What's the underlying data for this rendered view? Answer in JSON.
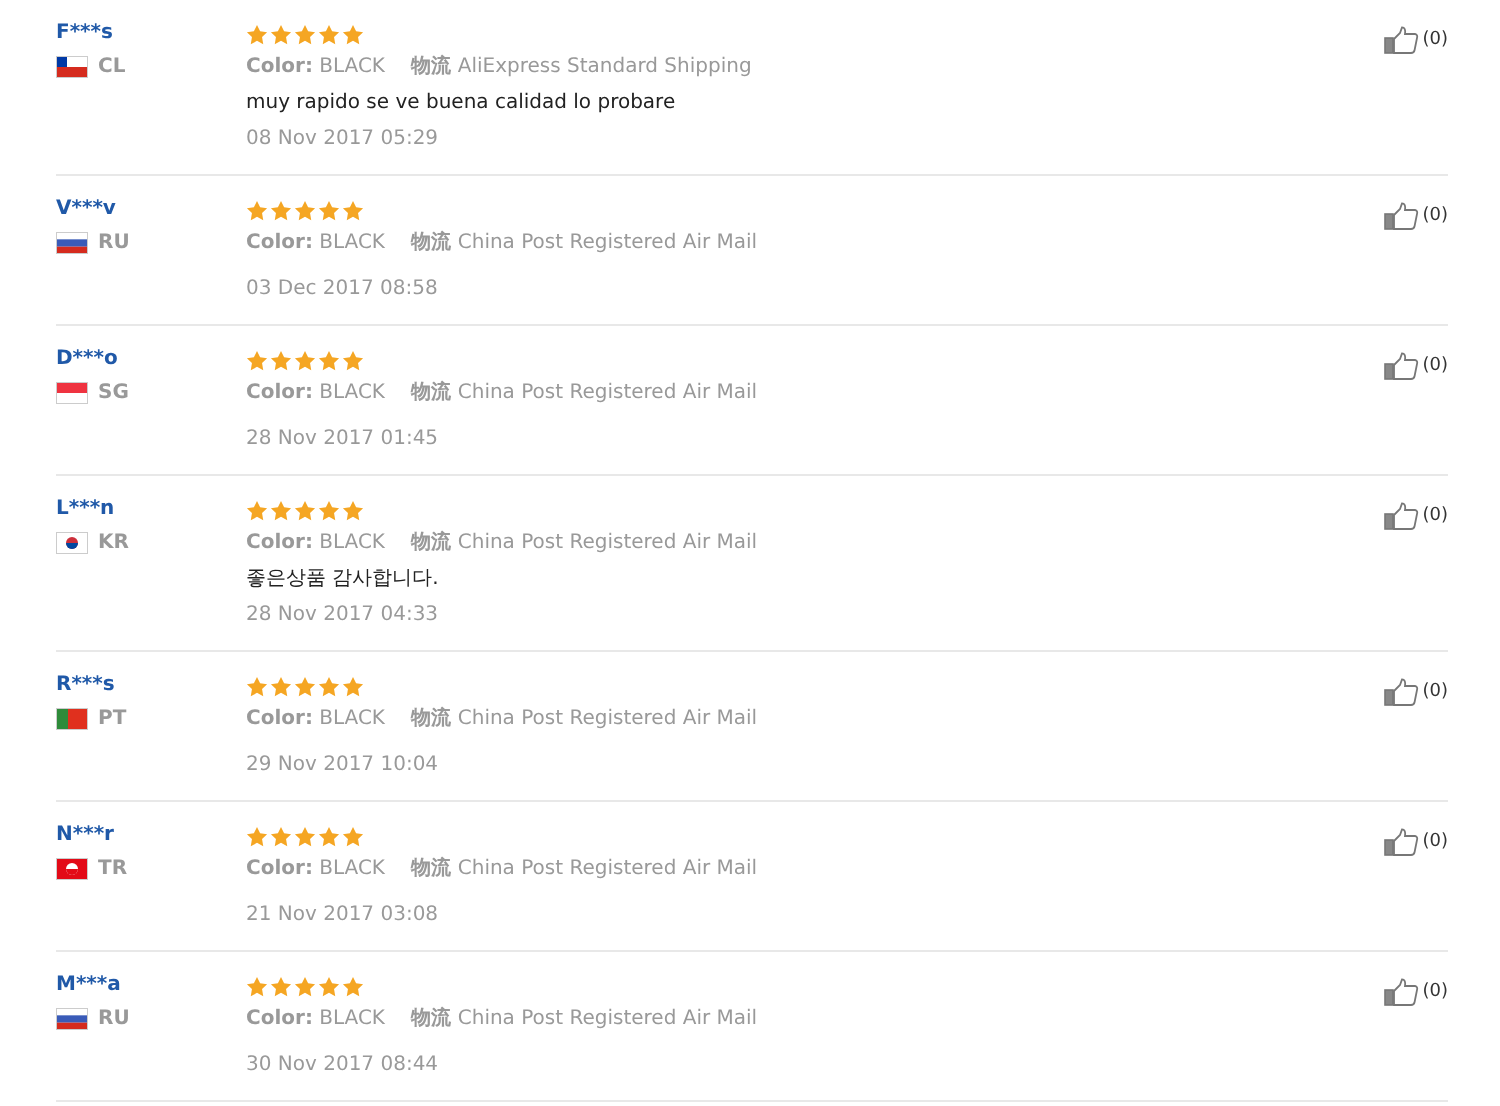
{
  "reviews": [
    {
      "name": "F***s",
      "country": "CL",
      "flag": {
        "kind": "chile"
      },
      "stars": 5,
      "color_label": "Color:",
      "color_value": "BLACK",
      "shipping_label": "物流",
      "shipping": "AliExpress Standard Shipping",
      "comment": "muy rapido se ve buena calidad lo probare",
      "date": "08 Nov 2017 05:29",
      "likes": "(0)"
    },
    {
      "name": "V***v",
      "country": "RU",
      "flag": {
        "kind": "russia"
      },
      "stars": 5,
      "color_label": "Color:",
      "color_value": "BLACK",
      "shipping_label": "物流",
      "shipping": "China Post Registered Air Mail",
      "date": "03 Dec 2017 08:58",
      "likes": "(0)"
    },
    {
      "name": "D***o",
      "country": "SG",
      "flag": {
        "kind": "singapore"
      },
      "stars": 5,
      "color_label": "Color:",
      "color_value": "BLACK",
      "shipping_label": "物流",
      "shipping": "China Post Registered Air Mail",
      "date": "28 Nov 2017 01:45",
      "likes": "(0)"
    },
    {
      "name": "L***n",
      "country": "KR",
      "flag": {
        "kind": "korea"
      },
      "stars": 5,
      "color_label": "Color:",
      "color_value": "BLACK",
      "shipping_label": "物流",
      "shipping": "China Post Registered Air Mail",
      "comment": "좋은상품 감사합니다.",
      "date": "28 Nov 2017 04:33",
      "likes": "(0)"
    },
    {
      "name": "R***s",
      "country": "PT",
      "flag": {
        "kind": "portugal"
      },
      "stars": 5,
      "color_label": "Color:",
      "color_value": "BLACK",
      "shipping_label": "物流",
      "shipping": "China Post Registered Air Mail",
      "date": "29 Nov 2017 10:04",
      "likes": "(0)"
    },
    {
      "name": "N***r",
      "country": "TR",
      "flag": {
        "kind": "turkey"
      },
      "stars": 5,
      "color_label": "Color:",
      "color_value": "BLACK",
      "shipping_label": "物流",
      "shipping": "China Post Registered Air Mail",
      "date": "21 Nov 2017 03:08",
      "likes": "(0)"
    },
    {
      "name": "M***a",
      "country": "RU",
      "flag": {
        "kind": "russia"
      },
      "stars": 5,
      "color_label": "Color:",
      "color_value": "BLACK",
      "shipping_label": "物流",
      "shipping": "China Post Registered Air Mail",
      "date": "30 Nov 2017 08:44",
      "likes": "(0)"
    }
  ]
}
